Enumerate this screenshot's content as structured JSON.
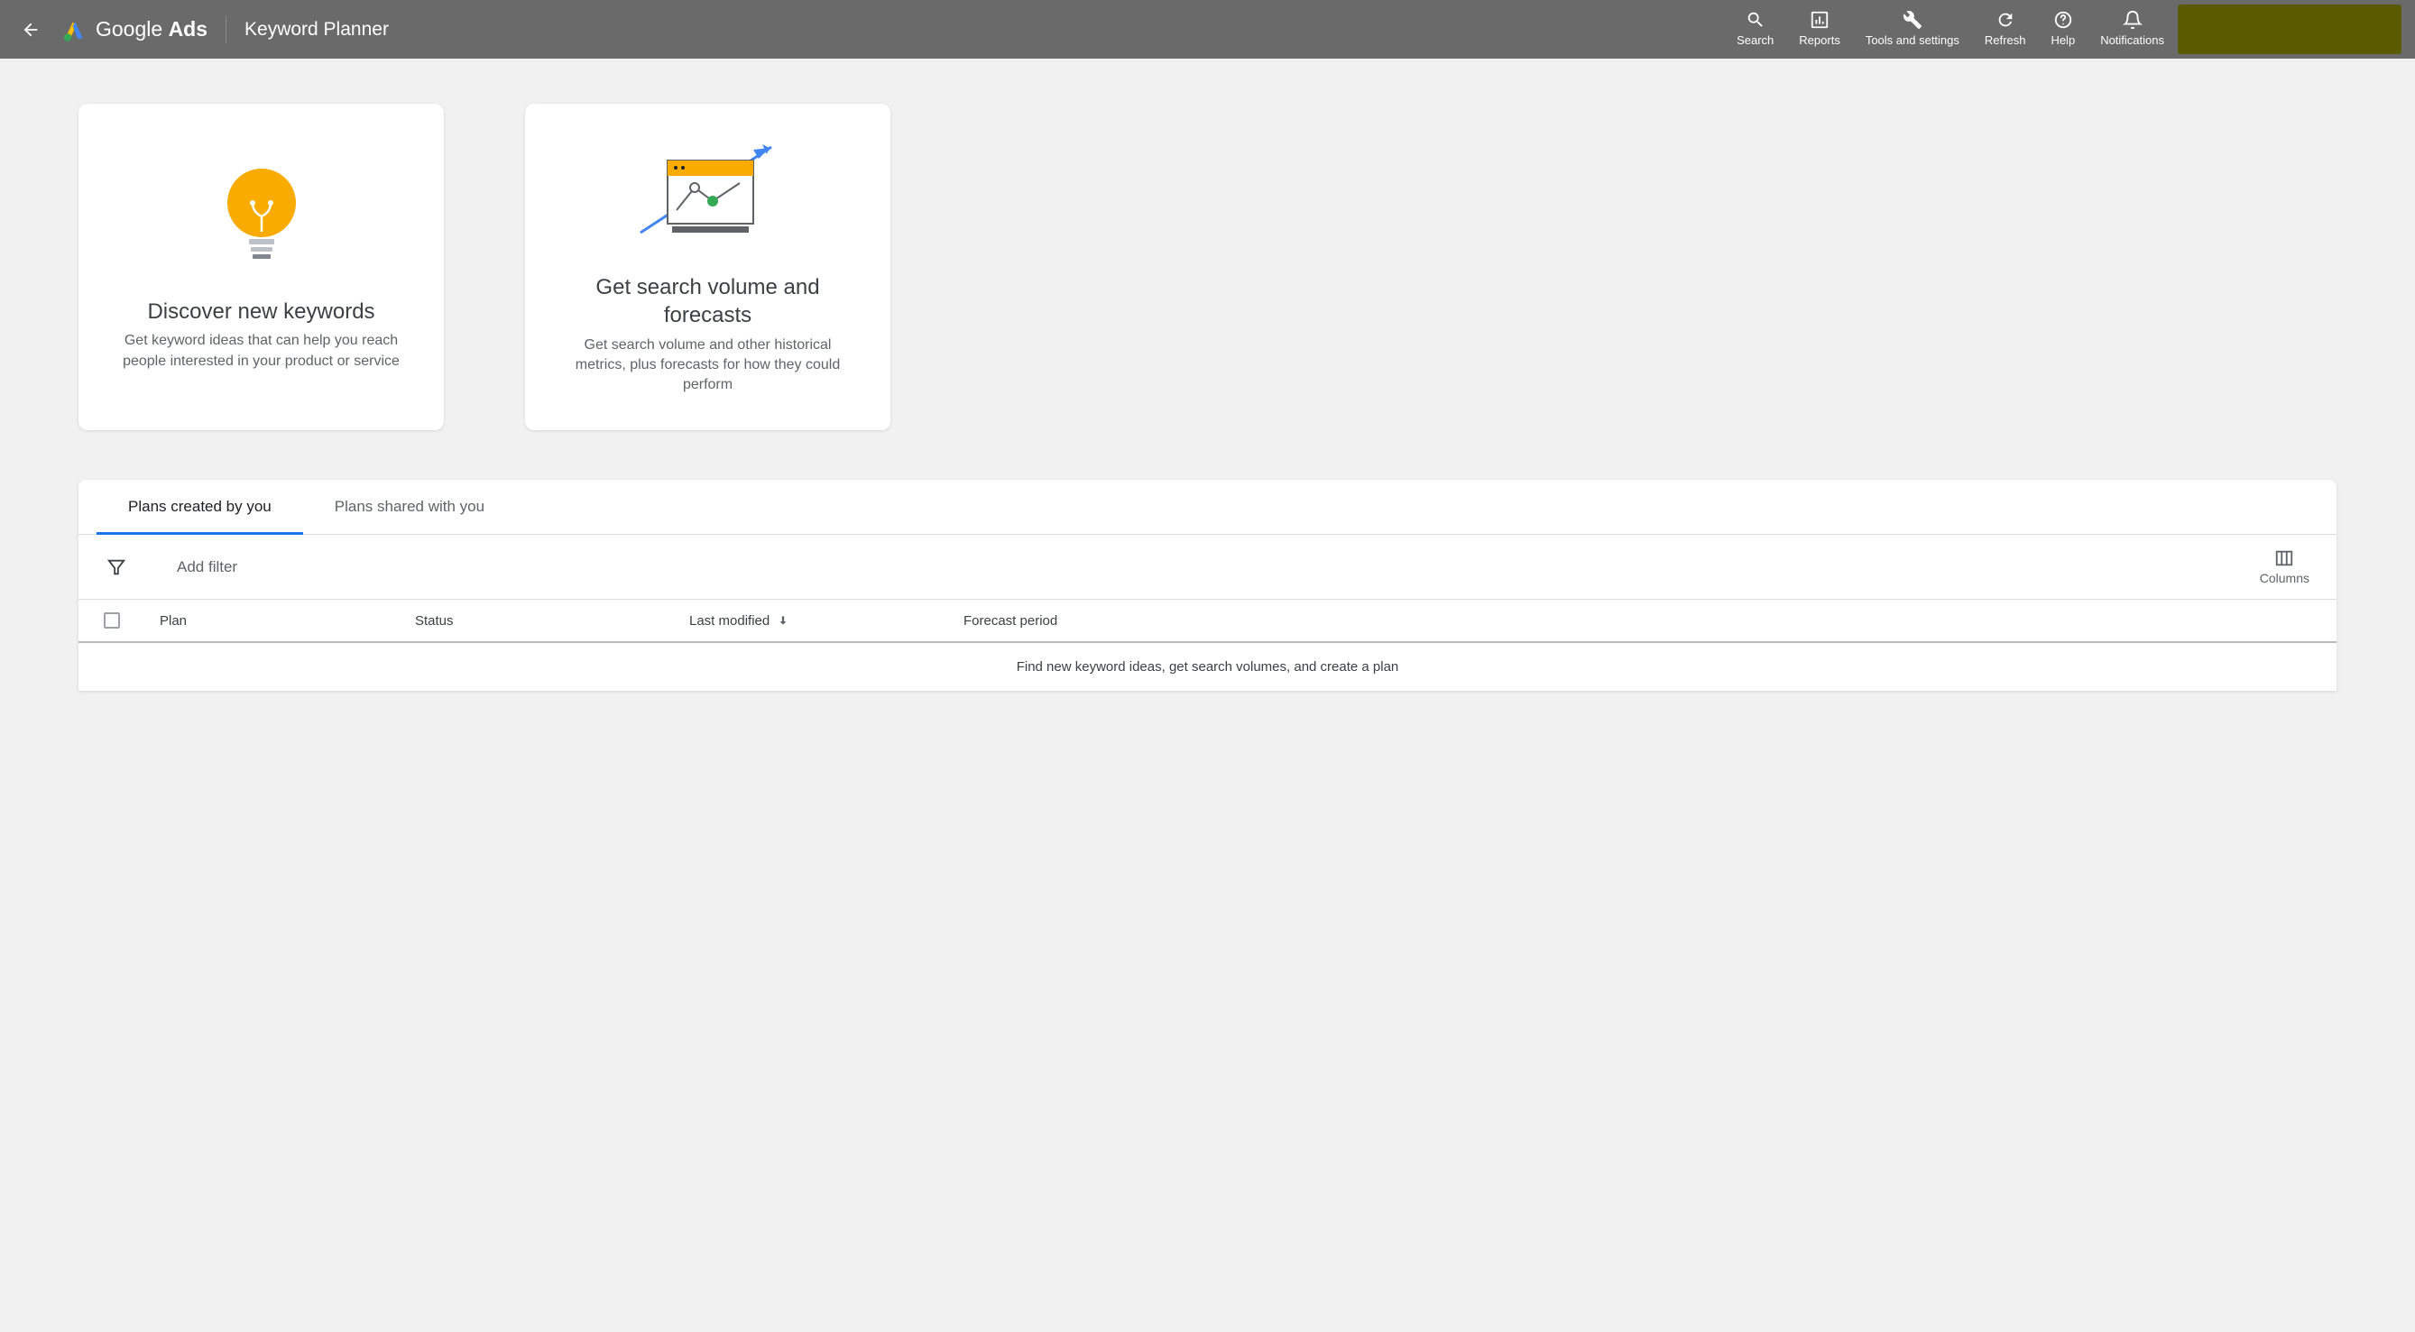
{
  "header": {
    "brand_google": "Google",
    "brand_ads": "Ads",
    "page_title": "Keyword Planner",
    "actions": {
      "search": "Search",
      "reports": "Reports",
      "tools": "Tools and settings",
      "refresh": "Refresh",
      "help": "Help",
      "notifications": "Notifications"
    }
  },
  "cards": {
    "discover": {
      "title": "Discover new keywords",
      "desc": "Get keyword ideas that can help you reach people interested in your product or service"
    },
    "forecast": {
      "title": "Get search volume and forecasts",
      "desc": "Get search volume and other historical metrics, plus forecasts for how they could perform"
    }
  },
  "tabs": {
    "created": "Plans created by you",
    "shared": "Plans shared with you"
  },
  "filter": {
    "add_filter": "Add filter",
    "columns": "Columns"
  },
  "table": {
    "headers": {
      "plan": "Plan",
      "status": "Status",
      "modified": "Last modified",
      "forecast": "Forecast period"
    },
    "empty": "Find new keyword ideas, get search volumes, and create a plan"
  }
}
